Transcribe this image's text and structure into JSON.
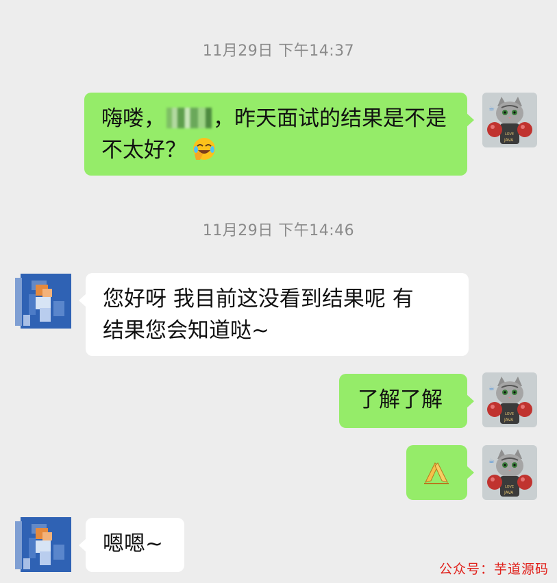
{
  "chat": {
    "messages": [
      {
        "type": "time",
        "text": "11月29日 下午14:37"
      },
      {
        "type": "sent",
        "text_before": "嗨喽，",
        "redacted": "blurred-name",
        "text_after": "，昨天面试的结果是不是不太好？",
        "emoji": "crying-laughing-emoji"
      },
      {
        "type": "time",
        "text": "11月29日 下午14:46"
      },
      {
        "type": "received",
        "line1": "您好呀 我目前这没看到结果呢 有",
        "line2": "结果您会知道哒~"
      },
      {
        "type": "sent",
        "text": "了解了解"
      },
      {
        "type": "sent",
        "emoji": "folded-hands-emoji"
      },
      {
        "type": "received",
        "text": "嗯嗯~"
      }
    ]
  },
  "avatars": {
    "me": {
      "description_icon": "cat-boxer-avatar",
      "shirt_text_1": "LOVE",
      "shirt_text_2": "JAVA"
    },
    "other": {
      "description_icon": "pixelated-avatar"
    }
  },
  "watermark": "公众号：芋道源码",
  "colors": {
    "sent_bubble": "#95ec69",
    "received_bubble": "#ffffff",
    "background": "#ededed",
    "watermark": "#e0211b"
  }
}
